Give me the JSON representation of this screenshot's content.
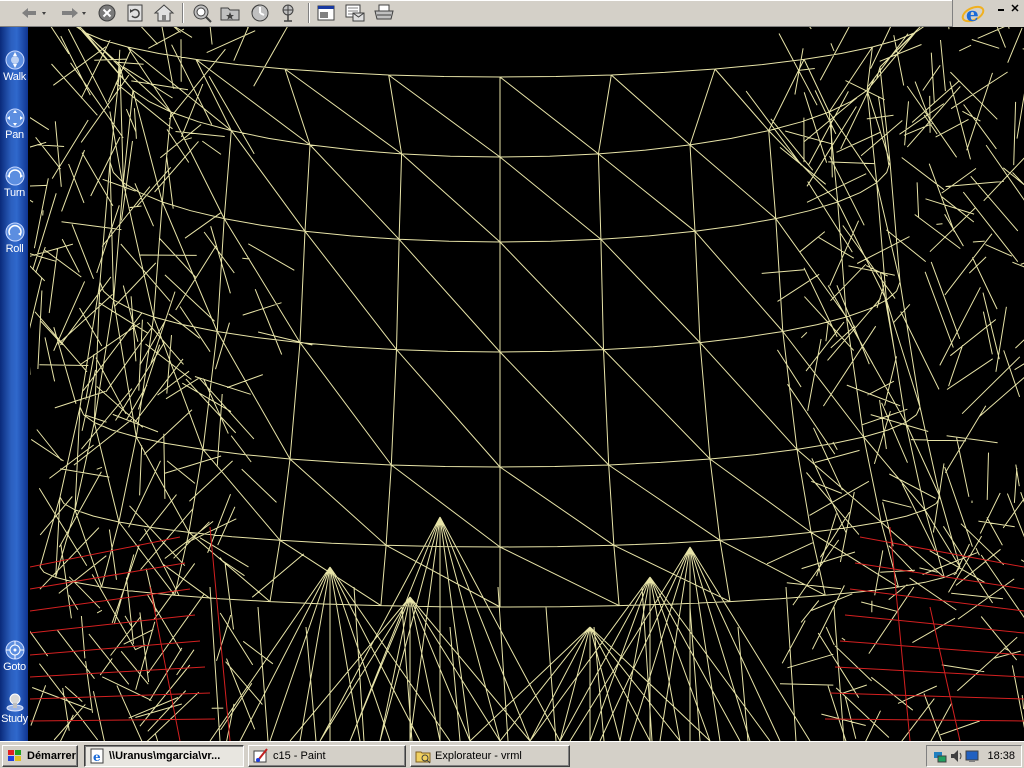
{
  "toolbar": {
    "buttons": [
      {
        "name": "back-button",
        "icon": "back-arrow-icon"
      },
      {
        "name": "forward-button",
        "icon": "forward-arrow-icon"
      },
      {
        "name": "stop-button",
        "icon": "stop-icon"
      },
      {
        "name": "refresh-button",
        "icon": "refresh-icon"
      },
      {
        "name": "home-button",
        "icon": "home-icon"
      },
      {
        "name": "search-button",
        "icon": "search-icon"
      },
      {
        "name": "favorites-button",
        "icon": "favorites-icon"
      },
      {
        "name": "history-button",
        "icon": "history-icon"
      },
      {
        "name": "channels-button",
        "icon": "channels-icon"
      },
      {
        "name": "fullscreen-button",
        "icon": "fullscreen-icon"
      },
      {
        "name": "mail-button",
        "icon": "mail-icon"
      },
      {
        "name": "print-button",
        "icon": "print-icon"
      }
    ],
    "brand_icon": "ie-logo-icon"
  },
  "navbar": {
    "walk": "Walk",
    "pan": "Pan",
    "turn": "Turn",
    "roll": "Roll",
    "goto": "Goto",
    "study": "Study"
  },
  "colors": {
    "wireframe": "#e8e4a8",
    "wireframe_red": "#d42020",
    "nav_blue": "#2f68cc",
    "chrome": "#d4d0c8"
  },
  "taskbar": {
    "start": "Démarrer",
    "tasks": [
      "\\\\Uranus\\mgarcia\\vr...",
      "c15 - Paint",
      "Explorateur - vrml"
    ],
    "clock": "18:38"
  }
}
